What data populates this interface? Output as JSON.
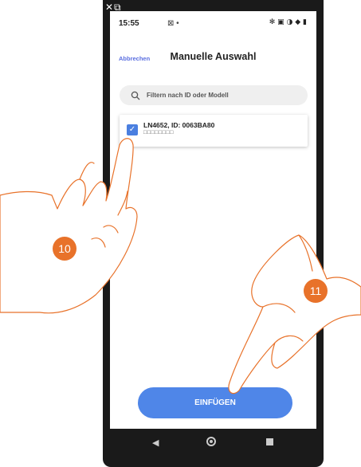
{
  "window_icons": "✕⧉",
  "status_bar": {
    "time": "15:55",
    "mid_icons": "⊠ •",
    "right_icons": "✻ ▣ ◑ ◆ ▮"
  },
  "header": {
    "cancel_label": "Abbrechen",
    "title": "Manuelle Auswahl"
  },
  "search": {
    "placeholder": "Filtern nach ID oder Modell"
  },
  "device_list": [
    {
      "name": "LN4652, ID: 0063BA80",
      "subtitle": "□□□□□□□□",
      "checked": true
    }
  ],
  "insert_button": {
    "label": "EINFÜGEN"
  },
  "step_badges": [
    "10",
    "11"
  ],
  "colors": {
    "accent": "#4f86e8",
    "badge": "#e8722a"
  }
}
